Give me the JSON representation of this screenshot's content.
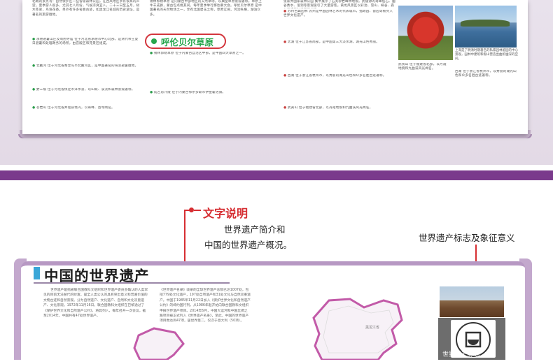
{
  "top_spread": {
    "callout_label": "呼伦贝尔草原",
    "left_column_text": "北端的景点有：自然保护区一些省级森林公园，在西风地区享有很高的声望。夏季游人很多，尤其七八月份，气候凉爽宜人。二十三日至五月，树木苍翠，鸟语花香。另外有许多名胜古迹，如黑龙江名城的历史遗址，是著名的旅游胜地。",
    "left_bullets": [
      "承德避暑山庄及周围寺庙 位于河北省承德市中心北部，是清代帝王夏日避暑和处理政务的场所，由宫殿区和苑景区组成。",
      "北戴河 位于河北省秦皇岛市北戴河区，是中国著名的海滨避暑胜地。",
      "野三坡 位于河北省保定市涞水县，以山峡、溪流和森林景观著称。",
      "苍岩山 位于河北省井陉县境内，以奇峰、古寺闻名。"
    ],
    "middle_column_text": "锡林郭勒草原 是内蒙古中部地区的天然草场，以典型草原景观著称。草原上牛羊成群，蒙古包点缀其间，每年夏季举行那达慕大会。呼伦贝尔草原 是中国著名的天然牧场之一，享有北国碧玉之称，草原辽阔，河流纵横，湖泊众多。",
    "middle_bullets": [
      "锡林郭勒草原 位于内蒙古自治区中部，是中国四大草原之一。",
      "成吉思汗陵 位于内蒙古鄂尔多斯市伊金霍洛旗。"
    ],
    "right_column_text": "张家界国家森林公园 集中展示了石英砂岩峰林地貌。武陵源的奇峰怪石、幽谷秀水、溶洞等景观吸引了大量游客。黄龙风景区以彩池、雪山、峡谷、森林构成的独特景观闻名。",
    "right_bullets": [
      "苏州古典园林 苏州是中国园林艺术的代表城市，拙政园、留园等被列入世界文化遗产。",
      "太湖 位于江苏省南部，是中国第三大淡水湖，湖光山色秀丽。",
      "西湖 位于浙江省杭州市，以秀丽的湖光山色和众多名胜古迹著称。",
      "武夷山 位于福建省北部，以丹霞地貌和九曲溪风光闻名。"
    ],
    "photo_caption": "上海是了明清时期著名的私家园林留园的中心景观，园林中建筑和假山营造出曲折幽深的空间。"
  },
  "annotation_left": {
    "title": "文字说明",
    "line1": "世界遗产简介和",
    "line2": "中国的世界遗产概况。"
  },
  "annotation_right": {
    "text": "世界遗产标志及象征意义"
  },
  "bottom_spread": {
    "section_title": "中国的世界遗产",
    "col1_text": "世界遗产是指被联合国教科文组织和世界遗产委员会确认的人类罕见的目前无法替代的财富，是全人类公认的具有突出意义和普遍价值的文物古迹和自然景观。分为自然遗产、文化遗产、自然和文化双重遗产、文化景观。1972年11月16日，联合国教科文组织在巴黎通过了《保护世界文化和自然遗产公约》，将其列入，每年召开一次会议，截至2014年，中国共有47处世界遗产。",
    "col2_text": "《世界遗产名录》收录的全球世界遗产总数已达1007处，包括779处文化遗产，197处自然遗产和31处文化与自然双重遗产。中国于1985年11月22日加入《保护世界文化和自然遗产公约》的缔约国行列，从1986年起开始向联合国教科文组织申报世界遗产项目。2014年6月，中国大运河和中国丝绸之路项目被正式列入《世界遗产名录》，至此，中国的世界遗产项目数达到47项，居世界第二，仅次于意大利（50项）。",
    "map_label": "黑龙江省",
    "emblem_caption": "世界遗产标志"
  }
}
